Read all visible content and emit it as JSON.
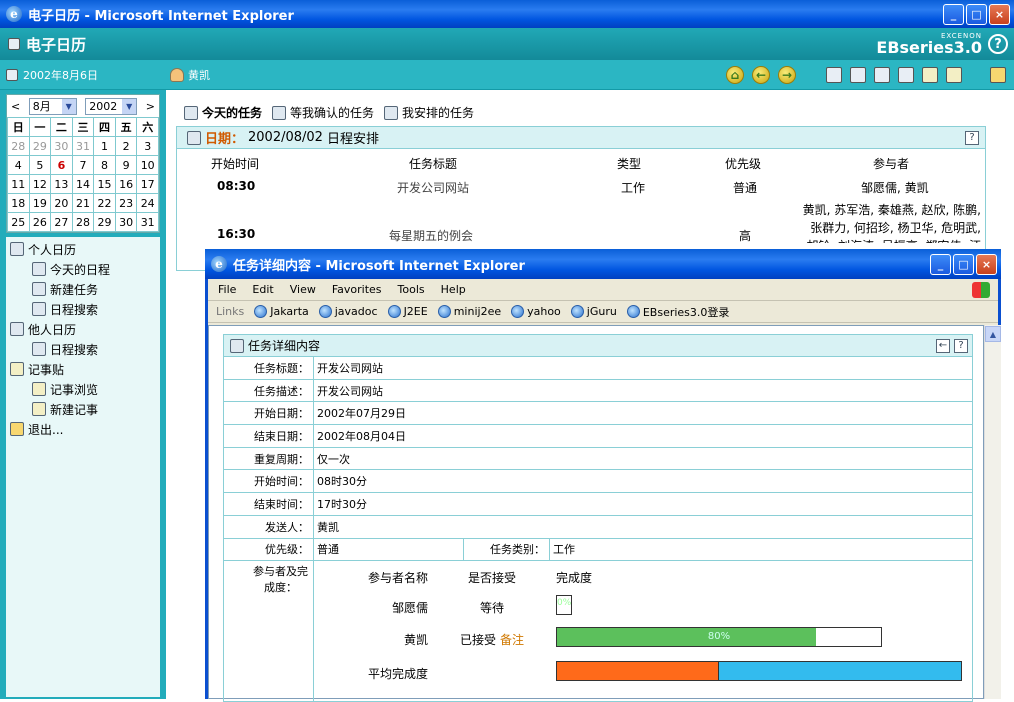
{
  "window": {
    "title": "电子日历 - Microsoft Internet Explorer",
    "controls": [
      "_",
      "□",
      "×"
    ]
  },
  "app": {
    "title": "电子日历",
    "brand_small": "EXCENON",
    "brand": "EBseries3.0",
    "help": "?"
  },
  "toolbar": {
    "date": "2002年8月6日",
    "user": "黄凯",
    "nav_icons": [
      "home-icon",
      "back-icon",
      "forward-icon"
    ],
    "action_icons": [
      "today-icon",
      "new-task-icon",
      "search-icon",
      "people-search-icon",
      "notes-icon",
      "new-note-icon",
      "exit-icon"
    ]
  },
  "calendar": {
    "prev": "<",
    "next": ">",
    "month": "8月",
    "year": "2002",
    "weekdays": [
      "日",
      "一",
      "二",
      "三",
      "四",
      "五",
      "六"
    ],
    "weeks": [
      [
        "28",
        "29",
        "30",
        "31",
        "1",
        "2",
        "3"
      ],
      [
        "4",
        "5",
        "6",
        "7",
        "8",
        "9",
        "10"
      ],
      [
        "11",
        "12",
        "13",
        "14",
        "15",
        "16",
        "17"
      ],
      [
        "18",
        "19",
        "20",
        "21",
        "22",
        "23",
        "24"
      ],
      [
        "25",
        "26",
        "27",
        "28",
        "29",
        "30",
        "31"
      ]
    ],
    "today": "6"
  },
  "sidebar": {
    "personal": "个人日历",
    "today_schedule": "今天的日程",
    "new_task": "新建任务",
    "schedule_search": "日程搜索",
    "others": "他人日历",
    "others_search": "日程搜索",
    "notes": "记事贴",
    "notes_browse": "记事浏览",
    "new_note": "新建记事",
    "exit": "退出..."
  },
  "tabs": {
    "today": "今天的任务",
    "confirm": "等我确认的任务",
    "arranged": "我安排的任务"
  },
  "schedule": {
    "date_label": "日期：",
    "date": "2002/08/02",
    "suffix": "日程安排",
    "help": "?",
    "columns": [
      "开始时间",
      "任务标题",
      "类型",
      "优先级",
      "参与者"
    ],
    "rows": [
      {
        "time": "08:30",
        "title": "开发公司网站",
        "type": "工作",
        "priority": "普通",
        "people": "邹愿儒, 黄凯"
      },
      {
        "time": "16:30",
        "title": "每星期五的例会",
        "type": "",
        "priority": "高",
        "people": "黄凯, 苏军浩, 秦雄燕, 赵欣, 陈鹏, 张群力, 何招珍, 杨卫华, 危明武, 胡铃, 刘海涛, 吴振亨, 郑宏伟, 汪剑南,"
      }
    ]
  },
  "popup": {
    "title": "任务详细内容 - Microsoft Internet Explorer",
    "menu": [
      "File",
      "Edit",
      "View",
      "Favorites",
      "Tools",
      "Help"
    ],
    "links_label": "Links",
    "links": [
      "Jakarta",
      "javadoc",
      "J2EE",
      "minij2ee",
      "yahoo",
      "jGuru",
      "EBseries3.0登录"
    ]
  },
  "detail": {
    "header": "任务详细内容",
    "fields": [
      {
        "label": "任务标题：",
        "value": "开发公司网站"
      },
      {
        "label": "任务描述：",
        "value": "开发公司网站"
      },
      {
        "label": "开始日期：",
        "value": "2002年07月29日"
      },
      {
        "label": "结束日期：",
        "value": "2002年08月04日"
      },
      {
        "label": "重复周期：",
        "value": "仅一次"
      },
      {
        "label": "开始时间：",
        "value": "08时30分"
      },
      {
        "label": "结束时间：",
        "value": "17时30分"
      },
      {
        "label": "发送人：",
        "value": "黄凯"
      }
    ],
    "priority_label": "优先级：",
    "priority_value": "普通",
    "category_label": "任务类别：",
    "category_value": "工作",
    "participants_label": "参与者及完成度：",
    "participant_cols": [
      "参与者名称",
      "是否接受",
      "完成度"
    ],
    "participants": [
      {
        "name": "邹愿儒",
        "status": "等待",
        "note": "",
        "progress": 0,
        "progress_text": "0%"
      },
      {
        "name": "黄凯",
        "status": "已接受",
        "note": "备注",
        "progress": 0.8,
        "progress_text": "80%"
      }
    ],
    "average_label": "平均完成度",
    "average_progress": 0.4,
    "colors": {
      "bar_green": "#5cc05c",
      "bar_orange": "#ff6a1a",
      "bar_blue": "#33bbee"
    }
  }
}
